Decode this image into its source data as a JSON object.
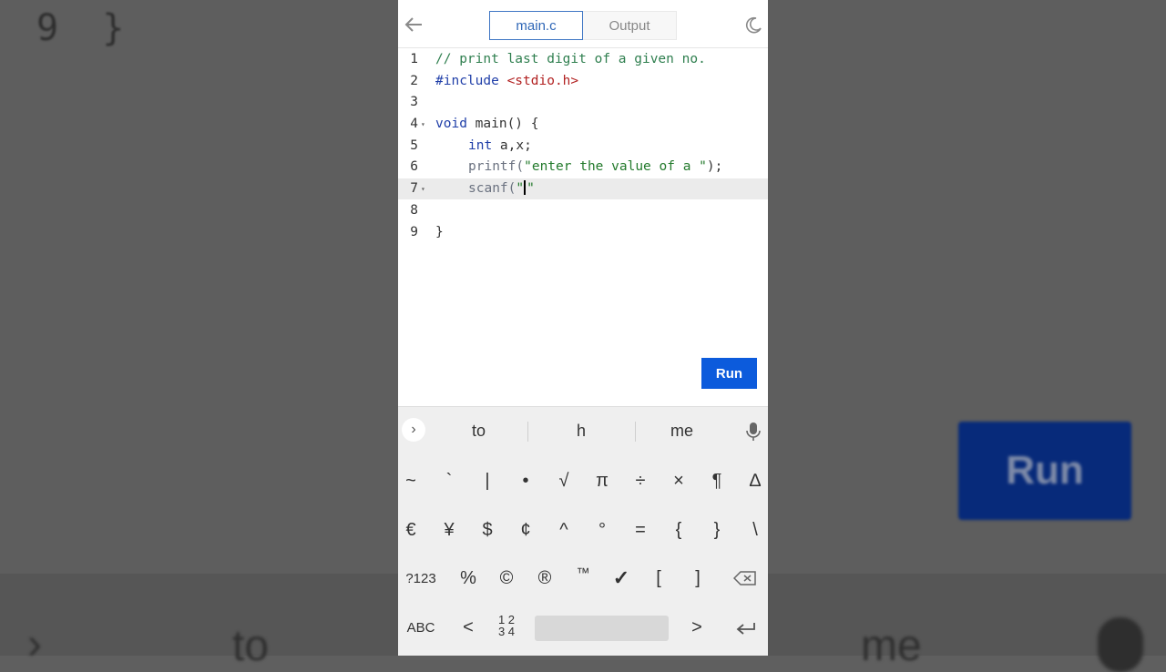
{
  "background": {
    "code_fragment": "9  }",
    "run_label": "Run",
    "suggestion_left": "to",
    "suggestion_right": "me"
  },
  "header": {
    "tabs": [
      {
        "label": "main.c",
        "active": true
      },
      {
        "label": "Output",
        "active": false
      }
    ]
  },
  "editor": {
    "line_numbers": [
      "1",
      "2",
      "3",
      "4",
      "5",
      "6",
      "7",
      "8",
      "9"
    ],
    "active_line": 7,
    "lines": {
      "l1_comment": "// print last digit of a given no.",
      "l2_include": "#include",
      "l2_header": "<stdio.h>",
      "l4_kw": "void",
      "l4_rest": " main() {",
      "l5_kw": "int",
      "l5_rest": " a,x;",
      "l6_func": "printf(",
      "l6_str": "\"enter the value of a \"",
      "l6_end": ");",
      "l7_func": "scanf(",
      "l7_quote_open": "\"",
      "l7_quote_close": "\"",
      "l9": "}"
    }
  },
  "run_button": {
    "label": "Run",
    "color": "#0c5bdc"
  },
  "keyboard": {
    "suggestions": [
      "to",
      "h",
      "me"
    ],
    "row1": [
      "~",
      "`",
      "|",
      "•",
      "√",
      "π",
      "÷",
      "×",
      "¶",
      "∆"
    ],
    "row2": [
      "€",
      "¥",
      "$",
      "¢",
      "^",
      "°",
      "=",
      "{",
      "}",
      "\\"
    ],
    "row3": [
      "?123",
      "%",
      "©",
      "®",
      "™",
      "✓",
      "[",
      "]"
    ],
    "row4": {
      "abc": "ABC",
      "lt": "<",
      "num_top": "1 2",
      "num_bottom": "3 4",
      "gt": ">"
    }
  }
}
